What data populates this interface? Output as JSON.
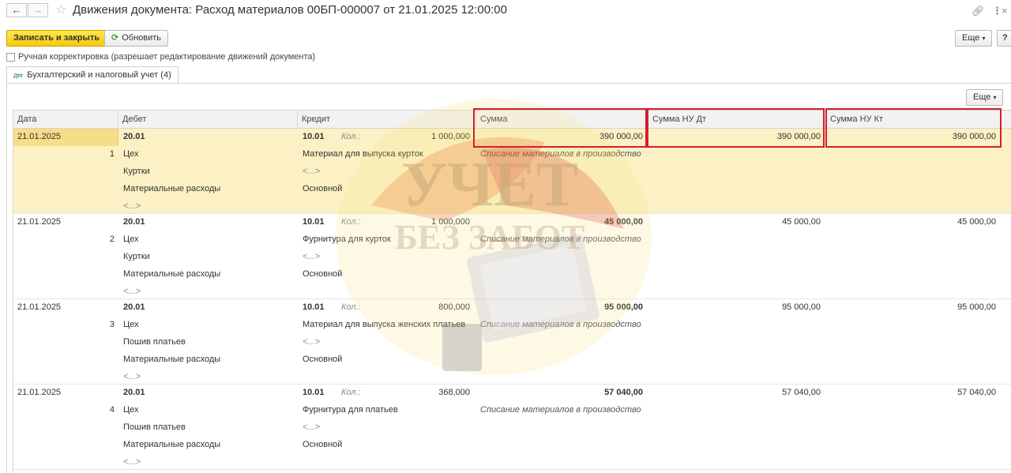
{
  "window": {
    "title": "Движения документа: Расход материалов 00БП-000007 от 21.01.2025 12:00:00",
    "back_icon": "arrow-left-icon",
    "forward_icon": "arrow-right-icon"
  },
  "toolbar": {
    "save_close_label": "Записать и закрыть",
    "refresh_label": "Обновить",
    "more_label": "Еще",
    "help_label": "?"
  },
  "manual": {
    "label": "Ручная корректировка (разрешает редактирование движений документа)",
    "checked": false
  },
  "tab": {
    "icon_text": "ДтКт",
    "label": "Бухгалтерский и налоговый учет (4)"
  },
  "grid_toolbar": {
    "more_label": "Еще"
  },
  "columns": {
    "date": "Дата",
    "debit": "Дебет",
    "credit": "Кредит",
    "sum": "Сумма",
    "sum_nu_dt": "Сумма НУ Дт",
    "sum_nu_kt": "Сумма НУ Кт"
  },
  "rows": [
    {
      "date": "21.01.2025",
      "num": "1",
      "debit_account": "20.01",
      "debit_sub1": "Цех",
      "debit_sub2": "Куртки",
      "debit_sub3": "Материальные расходы",
      "debit_sub4": "<...>",
      "credit_account": "10.01",
      "qty_label": "Кол.:",
      "qty": "1 000,000",
      "credit_sub1": "Материал для выпуска курток",
      "credit_sub2": "<...>",
      "credit_sub3": "Основной",
      "sum": "390 000,00",
      "content": "Списание материалов в производство",
      "sum_nu_dt": "390 000,00",
      "sum_nu_kt": "390 000,00",
      "selected": true
    },
    {
      "date": "21.01.2025",
      "num": "2",
      "debit_account": "20.01",
      "debit_sub1": "Цех",
      "debit_sub2": "Куртки",
      "debit_sub3": "Материальные расходы",
      "debit_sub4": "<...>",
      "credit_account": "10.01",
      "qty_label": "Кол.:",
      "qty": "1 000,000",
      "credit_sub1": "Фурнитура для курток",
      "credit_sub2": "<...>",
      "credit_sub3": "Основной",
      "sum": "45 000,00",
      "content": "Списание материалов в производство",
      "sum_nu_dt": "45 000,00",
      "sum_nu_kt": "45 000,00",
      "selected": false
    },
    {
      "date": "21.01.2025",
      "num": "3",
      "debit_account": "20.01",
      "debit_sub1": "Цех",
      "debit_sub2": "Пошив платьев",
      "debit_sub3": "Материальные расходы",
      "debit_sub4": "<...>",
      "credit_account": "10.01",
      "qty_label": "Кол.:",
      "qty": "800,000",
      "credit_sub1": "Материал для выпуска женских платьев",
      "credit_sub2": "<...>",
      "credit_sub3": "Основной",
      "sum": "95 000,00",
      "content": "Списание материалов в производство",
      "sum_nu_dt": "95 000,00",
      "sum_nu_kt": "95 000,00",
      "selected": false
    },
    {
      "date": "21.01.2025",
      "num": "4",
      "debit_account": "20.01",
      "debit_sub1": "Цех",
      "debit_sub2": "Пошив платьев",
      "debit_sub3": "Материальные расходы",
      "debit_sub4": "<...>",
      "credit_account": "10.01",
      "qty_label": "Кол.:",
      "qty": "368,000",
      "credit_sub1": "Фурнитура для платьев",
      "credit_sub2": "<...>",
      "credit_sub3": "Основной",
      "sum": "57 040,00",
      "content": "Списание материалов в производство",
      "sum_nu_dt": "57 040,00",
      "sum_nu_kt": "57 040,00",
      "selected": false
    }
  ],
  "watermark": {
    "line1": "УЧЕТ",
    "line2": "БЕЗ ЗАБОТ"
  },
  "colors": {
    "highlight_border": "#d21f2f",
    "selected_row": "#fbf1c4",
    "primary_button": "#f6c90e"
  }
}
